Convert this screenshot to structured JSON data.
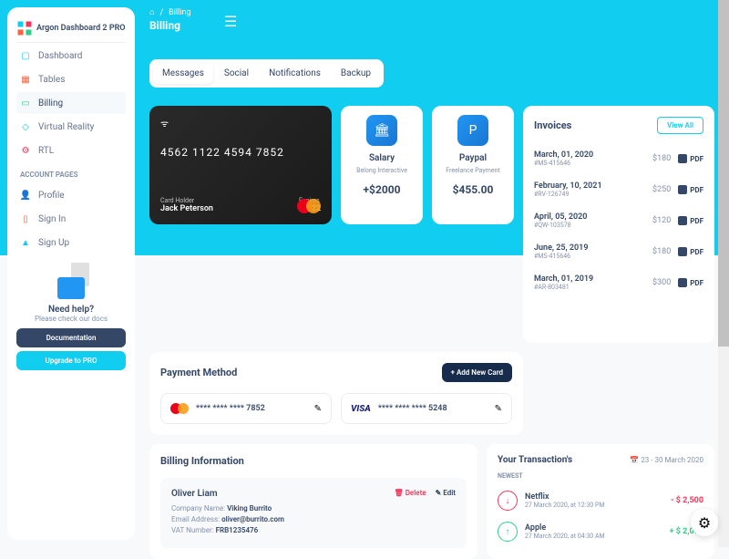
{
  "brand": "Argon Dashboard 2 PRO",
  "breadcrumb": {
    "parent": "Billing",
    "title": "Billing"
  },
  "sidebar": {
    "items": [
      {
        "label": "Dashboard",
        "icon": "display-icon"
      },
      {
        "label": "Tables",
        "icon": "calendar-icon"
      },
      {
        "label": "Billing",
        "icon": "credit-card-icon",
        "active": true
      },
      {
        "label": "Virtual Reality",
        "icon": "cube-icon"
      },
      {
        "label": "RTL",
        "icon": "tools-icon"
      }
    ],
    "section": "ACCOUNT PAGES",
    "account": [
      {
        "label": "Profile",
        "icon": "user-icon"
      },
      {
        "label": "Sign In",
        "icon": "document-icon"
      },
      {
        "label": "Sign Up",
        "icon": "rocket-icon"
      }
    ],
    "help": {
      "title": "Need help?",
      "sub": "Please check our docs",
      "docs": "Documentation",
      "upgrade": "Upgrade to PRO"
    }
  },
  "tabs": [
    "Messages",
    "Social",
    "Notifications",
    "Backup"
  ],
  "card": {
    "number": "4562   1122   4594   7852",
    "holder_label": "Card Holder",
    "holder": "Jack Peterson",
    "exp_label": "Expires",
    "exp": "11/22"
  },
  "stats": [
    {
      "title": "Salary",
      "sub": "Belong Interactive",
      "value": "+$2000"
    },
    {
      "title": "Paypal",
      "sub": "Freelance Payment",
      "value": "$455.00"
    }
  ],
  "invoices": {
    "title": "Invoices",
    "view_all": "View All",
    "pdf": "PDF",
    "items": [
      {
        "date": "March, 01, 2020",
        "id": "#MS-415646",
        "amount": "$180"
      },
      {
        "date": "February, 10, 2021",
        "id": "#RV-126749",
        "amount": "$250"
      },
      {
        "date": "April, 05, 2020",
        "id": "#QW-103578",
        "amount": "$120"
      },
      {
        "date": "June, 25, 2019",
        "id": "#MS-415646",
        "amount": "$180"
      },
      {
        "date": "March, 01, 2019",
        "id": "#AR-803481",
        "amount": "$300"
      }
    ]
  },
  "payment": {
    "title": "Payment Method",
    "add": "+ Add New Card",
    "cards": [
      {
        "brand": "mastercard",
        "masked": "****   ****   ****   7852"
      },
      {
        "brand": "visa",
        "masked": "****   ****   ****   5248"
      }
    ]
  },
  "billing": {
    "title": "Billing Information",
    "delete": "Delete",
    "edit": "Edit",
    "entry": {
      "name": "Oliver Liam",
      "company_label": "Company Name:",
      "company": "Viking Burrito",
      "email_label": "Email Address:",
      "email": "oliver@burrito.com",
      "vat_label": "VAT Number:",
      "vat": "FRB1235476"
    }
  },
  "transactions": {
    "title": "Your Transaction's",
    "range": "23 - 30 March 2020",
    "newest": "NEWEST",
    "items": [
      {
        "name": "Netflix",
        "time": "27 March 2020, at 12:30 PM",
        "amount": "- $ 2,500",
        "dir": "down"
      },
      {
        "name": "Apple",
        "time": "27 March 2020, at 04:30 AM",
        "amount": "+ $ 2,000",
        "dir": "up"
      }
    ]
  }
}
